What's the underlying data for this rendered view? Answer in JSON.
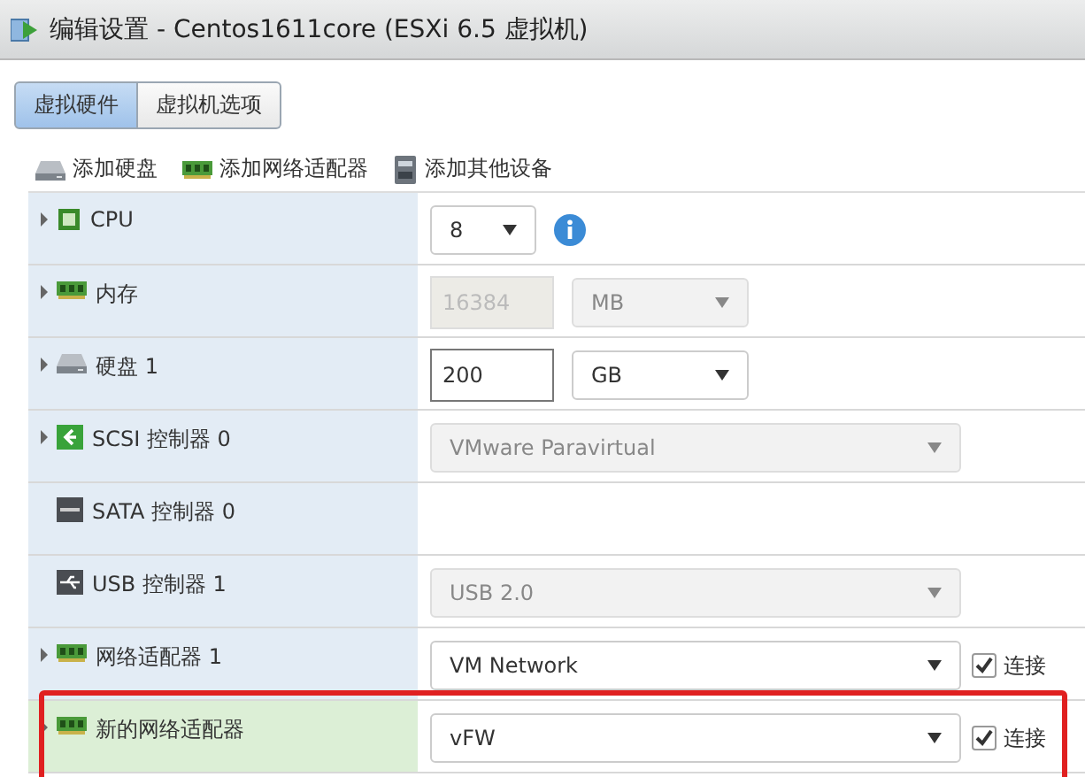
{
  "window": {
    "title": "编辑设置 - Centos1611core (ESXi 6.5 虚拟机)"
  },
  "tabs": [
    {
      "label": "虚拟硬件",
      "selected": true
    },
    {
      "label": "虚拟机选项",
      "selected": false
    }
  ],
  "toolbar": [
    {
      "kind": "disk",
      "label": "添加硬盘"
    },
    {
      "kind": "nic",
      "label": "添加网络适配器"
    },
    {
      "kind": "device",
      "label": "添加其他设备"
    }
  ],
  "rows": [
    {
      "label": "CPU",
      "kind": "cpu",
      "expandable": true,
      "new": false,
      "highlighted": false,
      "controls": [
        {
          "kind": "small-select",
          "value": "8",
          "disabled": false
        },
        {
          "kind": "info"
        }
      ]
    },
    {
      "label": "内存",
      "kind": "memory",
      "expandable": true,
      "new": false,
      "highlighted": false,
      "controls": [
        {
          "kind": "number-input",
          "value": "16384",
          "disabled": true
        },
        {
          "kind": "unit-select",
          "value": "MB",
          "disabled": true
        }
      ]
    },
    {
      "label": "硬盘 1",
      "kind": "disk",
      "expandable": true,
      "new": false,
      "highlighted": false,
      "controls": [
        {
          "kind": "number-input",
          "value": "200",
          "disabled": false
        },
        {
          "kind": "unit-select",
          "value": "GB",
          "disabled": false
        }
      ]
    },
    {
      "label": "SCSI 控制器 0",
      "kind": "scsi",
      "expandable": true,
      "new": false,
      "highlighted": false,
      "controls": [
        {
          "kind": "wide-select",
          "value": "VMware Paravirtual",
          "disabled": true
        }
      ]
    },
    {
      "label": "SATA 控制器 0",
      "kind": "sata",
      "expandable": false,
      "new": false,
      "highlighted": false,
      "controls": []
    },
    {
      "label": "USB 控制器 1",
      "kind": "usb",
      "expandable": false,
      "new": false,
      "highlighted": false,
      "controls": [
        {
          "kind": "wide-select",
          "value": "USB 2.0",
          "disabled": true
        }
      ]
    },
    {
      "label": "网络适配器 1",
      "kind": "nic",
      "expandable": true,
      "new": false,
      "highlighted": false,
      "controls": [
        {
          "kind": "wide-select",
          "value": "VM Network",
          "disabled": false
        },
        {
          "kind": "checkbox",
          "label": "连接",
          "checked": true
        }
      ]
    },
    {
      "label": "新的网络适配器",
      "kind": "nic",
      "expandable": true,
      "new": true,
      "highlighted": true,
      "controls": [
        {
          "kind": "wide-select",
          "value": "vFW",
          "disabled": false
        },
        {
          "kind": "checkbox",
          "label": "连接",
          "checked": true
        }
      ]
    }
  ]
}
